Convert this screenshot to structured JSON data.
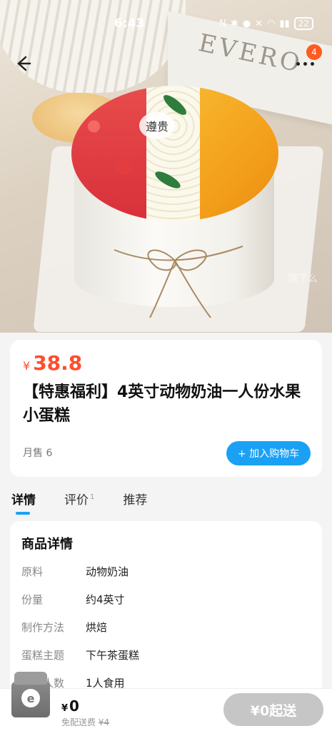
{
  "status_bar": {
    "time": "6:43",
    "battery": "22"
  },
  "nav": {
    "badge": "4"
  },
  "hero": {
    "tag": "遵贵",
    "book_text": "EVERO",
    "watermark": "饿了么"
  },
  "product": {
    "currency": "¥",
    "price": "38.8",
    "title": "【特惠福利】4英寸动物奶油一人份水果小蛋糕",
    "monthly_sales": "月售 6",
    "add_to_cart": "+ 加入购物车"
  },
  "tabs": [
    {
      "label": "详情"
    },
    {
      "label": "评价",
      "count": "1"
    },
    {
      "label": "推荐"
    }
  ],
  "details": {
    "heading": "商品详情",
    "rows": [
      {
        "k": "原料",
        "v": "动物奶油"
      },
      {
        "k": "份量",
        "v": "约4英寸"
      },
      {
        "k": "制作方法",
        "v": "烘焙"
      },
      {
        "k": "蛋糕主题",
        "v": "下午茶蛋糕"
      },
      {
        "k": "适合人数",
        "v": "1人食用"
      }
    ]
  },
  "bottom_bar": {
    "currency": "¥",
    "total": "0",
    "delivery_label": "免配送费",
    "delivery_original": "¥4",
    "checkout_label": "¥0起送",
    "cart_icon": "cart-box-icon"
  },
  "colors": {
    "accent": "#1aa1f5",
    "price": "#ff4d2d",
    "badge": "#ff5a1f"
  }
}
